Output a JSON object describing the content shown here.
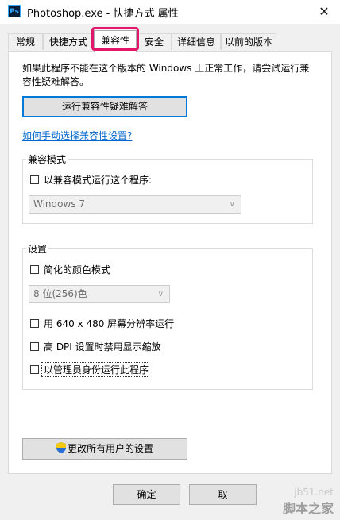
{
  "window": {
    "title": "Photoshop.exe - 快捷方式 属性",
    "app_icon_text": "Ps",
    "close_glyph": "✕"
  },
  "tabs": [
    {
      "label": "常规"
    },
    {
      "label": "快捷方式"
    },
    {
      "label": "兼容性",
      "active": true
    },
    {
      "label": "安全"
    },
    {
      "label": "详细信息"
    },
    {
      "label": "以前的版本"
    }
  ],
  "compat": {
    "intro": "如果此程序不能在这个版本的 Windows 上正常工作，请尝试运行兼容性疑难解答。",
    "troubleshoot_button": "运行兼容性疑难解答",
    "manual_link": "如何手动选择兼容性设置?"
  },
  "compat_mode": {
    "group_title": "兼容模式",
    "checkbox_label": "以兼容模式运行这个程序:",
    "os_selected": "Windows 7"
  },
  "settings": {
    "group_title": "设置",
    "reduced_color": "简化的颜色模式",
    "color_selected": "8 位(256)色",
    "run_640": "用 640 x 480 屏幕分辨率运行",
    "high_dpi": "高 DPI 设置时禁用显示缩放",
    "run_as_admin": "以管理员身份运行此程序"
  },
  "change_all_button": "更改所有用户的设置",
  "footer": {
    "ok": "确定",
    "cancel": "取"
  },
  "watermark": {
    "line1": "jb51.net",
    "line2": "脚本之家"
  },
  "colors": {
    "highlight": "#e2166a",
    "link": "#0066cc",
    "focus": "#0078d7"
  },
  "icons": [
    "photoshop-app-icon",
    "close-icon",
    "uac-shield-icon",
    "chevron-down-icon"
  ]
}
